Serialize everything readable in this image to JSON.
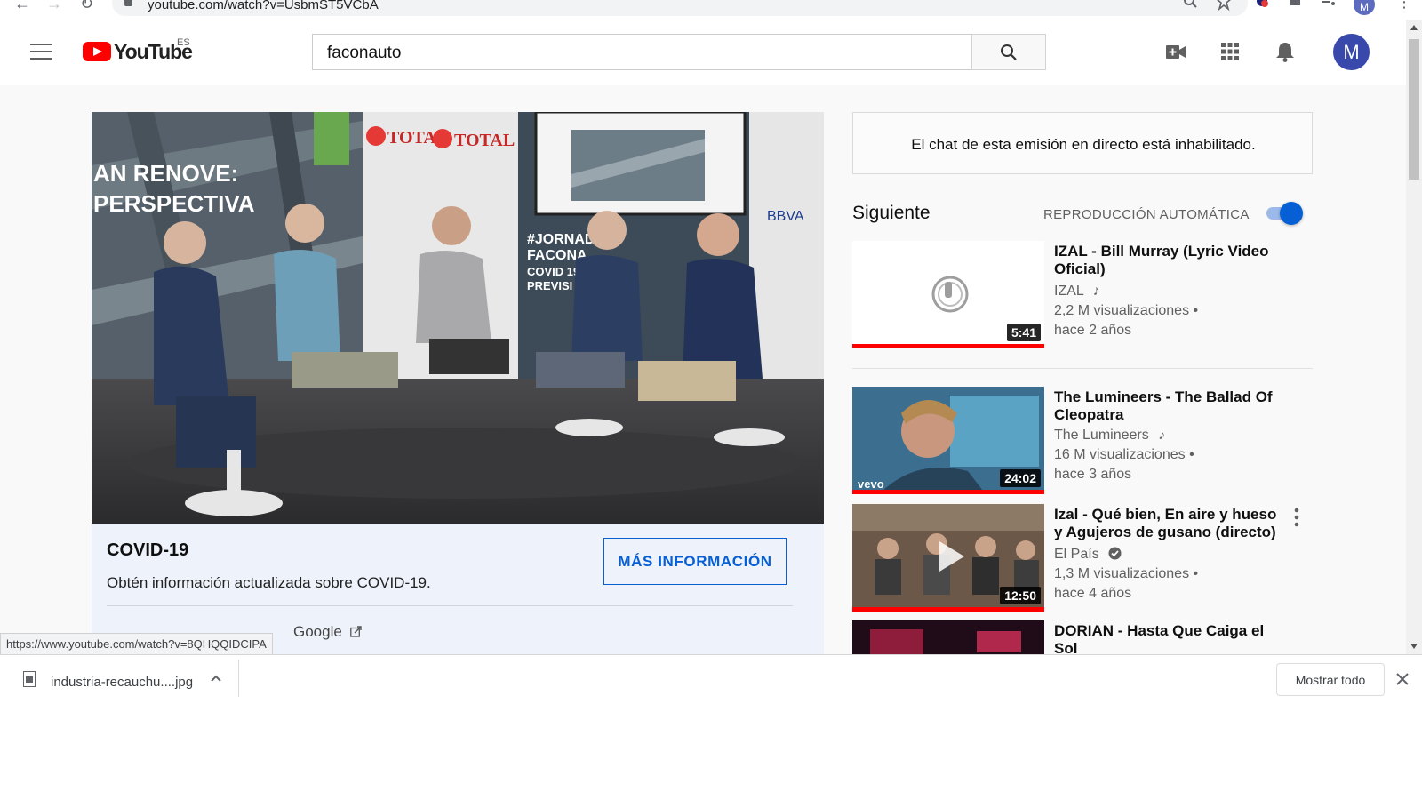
{
  "browser": {
    "url": "youtube.com/watch?v=UsbmST5VCbA",
    "profile_initial": "M"
  },
  "masthead": {
    "logo_text": "YouTube",
    "country_code": "ES",
    "search_value": "faconauto",
    "avatar_initial": "M",
    "brand_color": "#ff0000",
    "accent_color": "#065fd4"
  },
  "player": {
    "scene_text": {
      "sign_left_line1": "AN RENOVE:",
      "sign_left_line2": "PERSPECTIVA",
      "banner_brand": "TOTAL",
      "banner_brand_2": "TOTAL",
      "sponsor": "BBVA",
      "hashtag_line1": "#JORNADA",
      "hashtag_line2": "FACONA",
      "hashtag_line3": "COVID 19",
      "hashtag_line4": "PREVISI"
    }
  },
  "info_card": {
    "title": "COVID-19",
    "description": "Obtén información actualizada sobre COVID-19.",
    "button_label": "MÁS INFORMACIÓN",
    "source": "Google"
  },
  "sidebar": {
    "chat_disabled": "El chat de esta emisión en directo está inhabilitado.",
    "up_next": "Siguiente",
    "autoplay_label": "REPRODUCCIÓN AUTOMÁTICA",
    "autoplay_on": true,
    "recommendations": [
      {
        "title": "IZAL - Bill Murray (Lyric Video Oficial)",
        "channel": "IZAL",
        "channel_badge": "music-note-icon",
        "views": "2,2 M visualizaciones",
        "date": "hace 2 años",
        "duration": "5:41",
        "watched_fraction": 1.0
      },
      {
        "title": "The Lumineers - The Ballad Of Cleopatra",
        "channel": "The Lumineers",
        "channel_badge": "music-note-icon",
        "views": "16 M visualizaciones",
        "date": "hace 3 años",
        "duration": "24:02",
        "watched_fraction": 1.0,
        "thumb_label": "vevo"
      },
      {
        "title": "Izal - Qué bien, En aire y hueso y Agujeros de gusano (directo)",
        "channel": "El País",
        "channel_badge": "verified-check-icon",
        "views": "1,3 M visualizaciones",
        "date": "hace 4 años",
        "duration": "12:50",
        "watched_fraction": 1.0
      },
      {
        "title": "DORIAN - Hasta Que Caiga el Sol"
      }
    ]
  },
  "status_bar": {
    "url": "https://www.youtube.com/watch?v=8QHQQIDCIPA"
  },
  "download_shelf": {
    "file_name": "industria-recauchu....jpg",
    "show_all_label": "Mostrar todo"
  }
}
